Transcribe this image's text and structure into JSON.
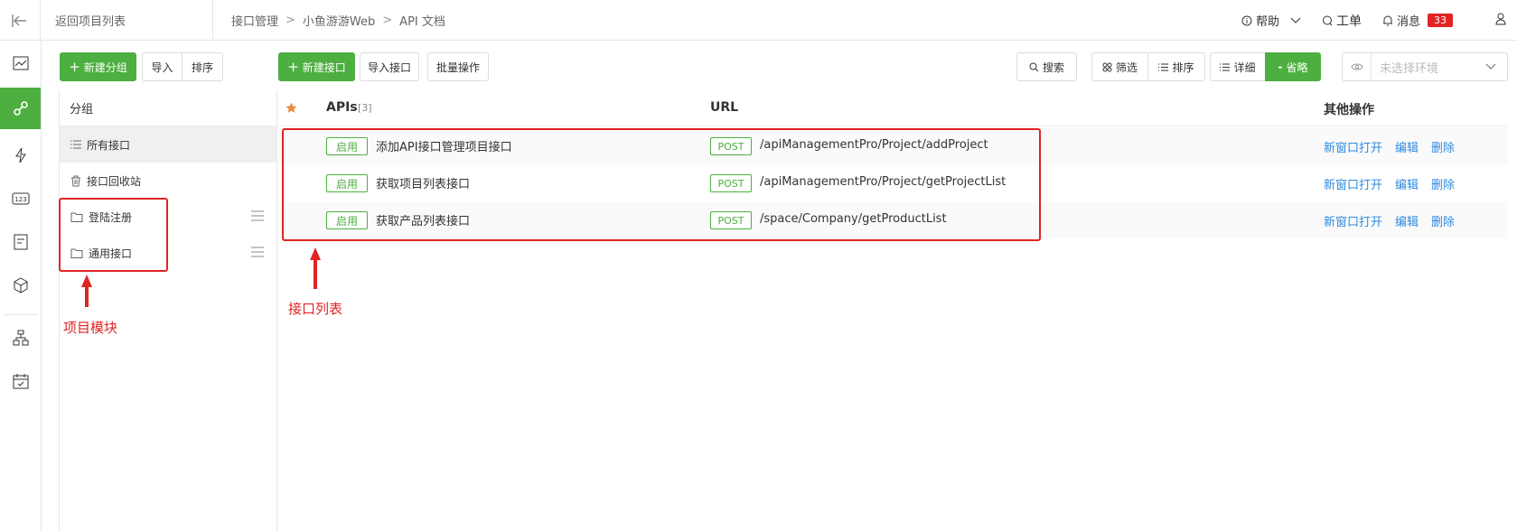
{
  "topbar": {
    "back_label": "返回项目列表",
    "breadcrumb": [
      "接口管理",
      "小鱼游游Web",
      "API 文档"
    ],
    "help_label": "帮助",
    "ticket_label": "工单",
    "message_label": "消息",
    "message_count": "33"
  },
  "rail": {
    "items": [
      "dashboard",
      "api",
      "test",
      "data",
      "doc",
      "package",
      "structure",
      "task"
    ]
  },
  "toolbar": {
    "new_group": "新建分组",
    "import": "导入",
    "sort": "排序",
    "new_api": "新建接口",
    "import_api": "导入接口",
    "batch": "批量操作",
    "search": "搜索",
    "filter": "筛选",
    "sort2": "排序",
    "detail": "详细",
    "brief": "省略",
    "env_placeholder": "未选择环境"
  },
  "groups": {
    "header": "分组",
    "items": [
      {
        "label": "所有接口",
        "active": true
      },
      {
        "label": "接口回收站"
      },
      {
        "label": "登陆注册"
      },
      {
        "label": "通用接口"
      }
    ]
  },
  "table": {
    "col_apis": "APIs",
    "api_count": "[3]",
    "col_url": "URL",
    "col_ops": "其他操作",
    "rows": [
      {
        "status": "启用",
        "name": "添加API接口管理项目接口",
        "method": "POST",
        "url": "/apiManagementPro/Project/addProject"
      },
      {
        "status": "启用",
        "name": "获取项目列表接口",
        "method": "POST",
        "url": "/apiManagementPro/Project/getProjectList"
      },
      {
        "status": "启用",
        "name": "获取产品列表接口",
        "method": "POST",
        "url": "/space/Company/getProductList"
      }
    ],
    "ops": {
      "open": "新窗口打开",
      "edit": "编辑",
      "delete": "删除"
    }
  },
  "annotations": {
    "module_label": "项目模块",
    "list_label": "接口列表",
    "color": "#e02424"
  },
  "colors": {
    "accent": "#4caf3f",
    "link": "#2f8ae0"
  }
}
